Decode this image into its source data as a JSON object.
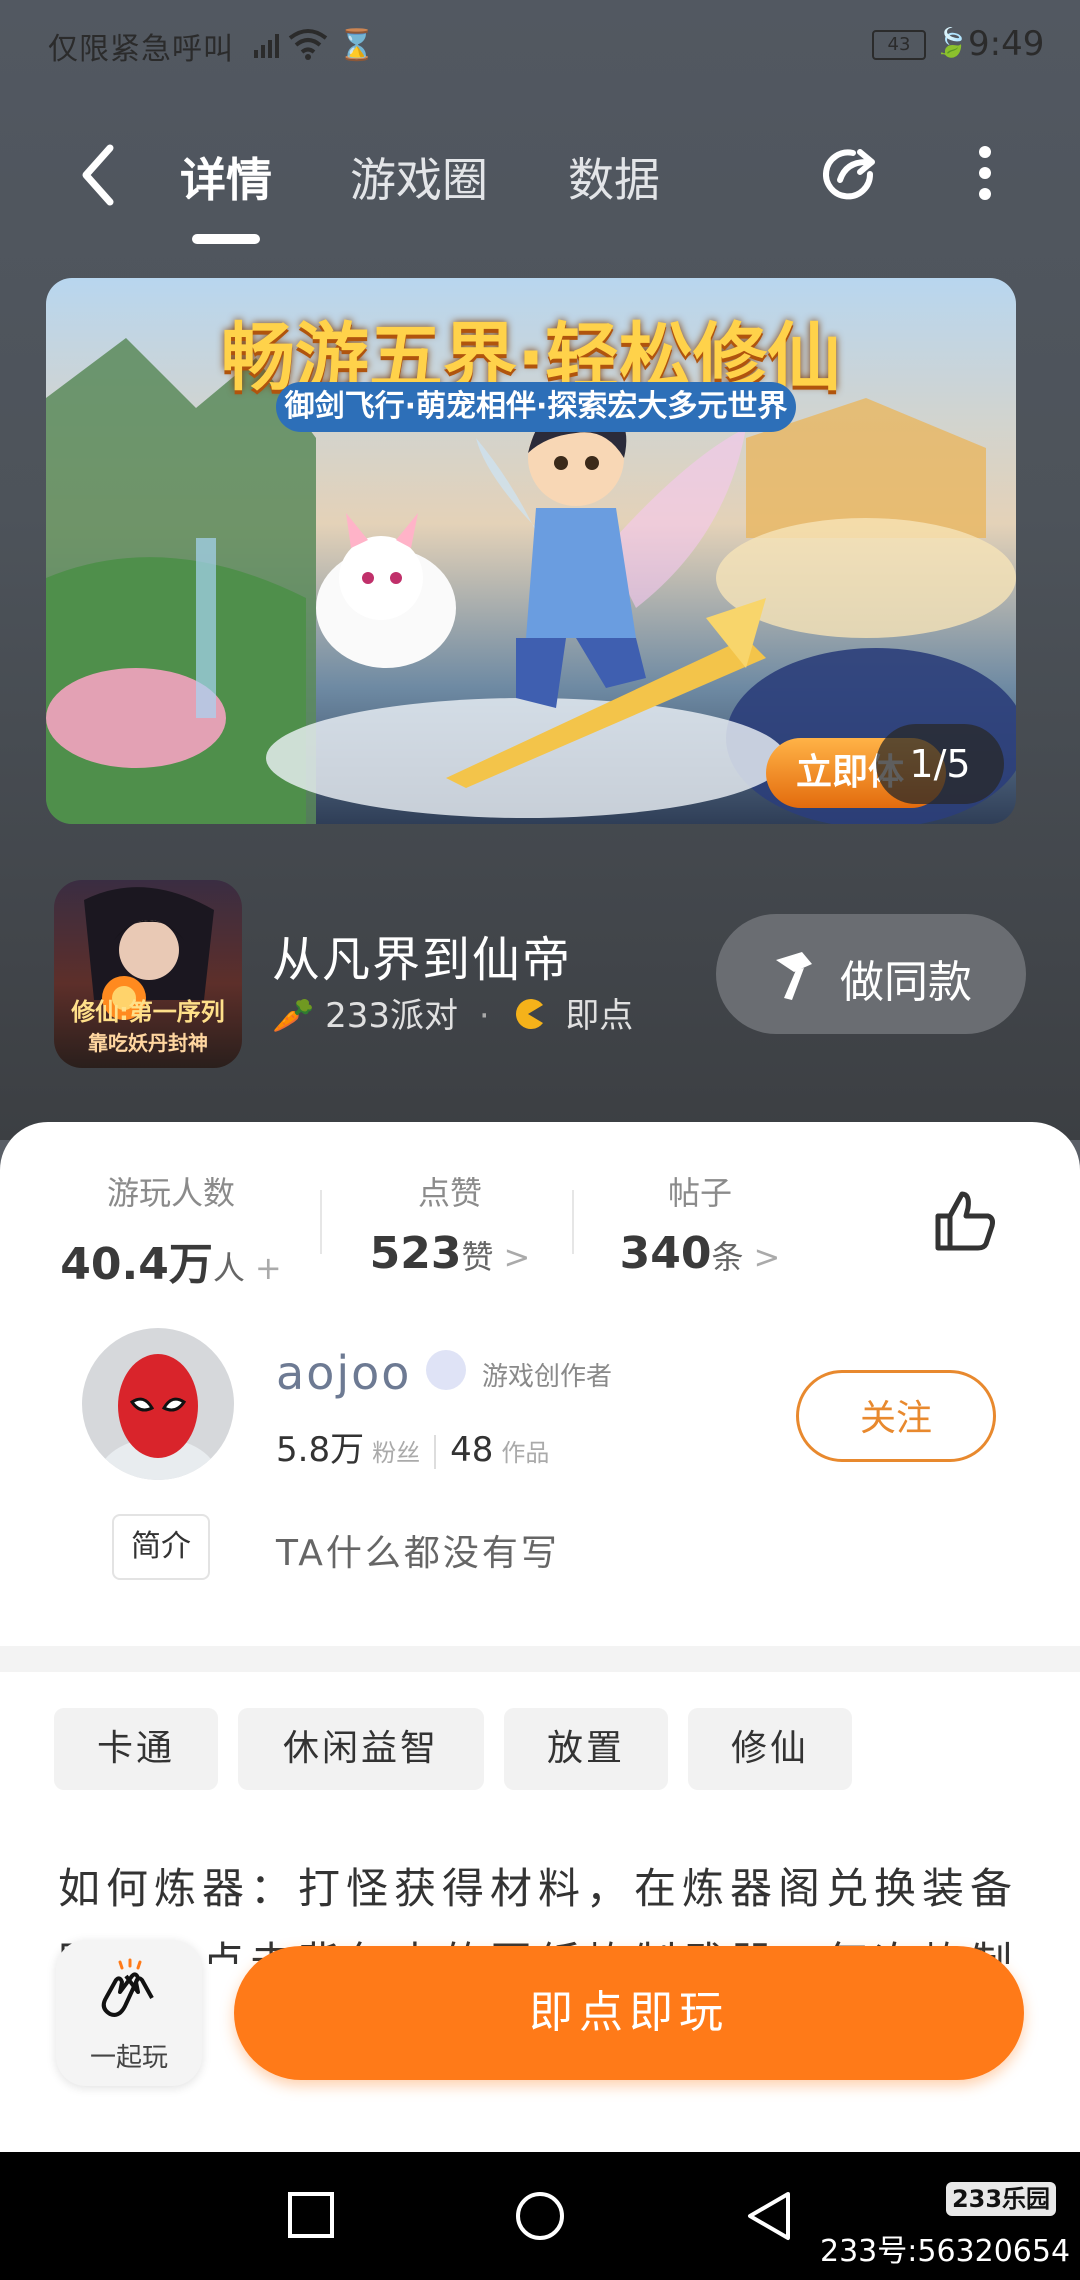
{
  "status_bar": {
    "left_text": "仅限紧急呼叫",
    "battery": "43",
    "time": "9:49"
  },
  "nav": {
    "tabs": [
      {
        "label": "详情"
      },
      {
        "label": "游戏圈"
      },
      {
        "label": "数据"
      }
    ]
  },
  "banner": {
    "title": "畅游五界·轻松修仙",
    "subtitle": "御剑飞行·萌宠相伴·探索宏大多元世界",
    "cta": "立即体",
    "pager": "1/5"
  },
  "game": {
    "icon_caption_line1": "修仙:第一序列",
    "icon_caption_line2": "靠吃妖丹封神",
    "name": "从凡界到仙帝",
    "source": "233派对",
    "type": "即点",
    "make_same_label": "做同款"
  },
  "stats": [
    {
      "label": "游玩人数",
      "value": "40.4万",
      "unit": "人",
      "suffix": "+"
    },
    {
      "label": "点赞",
      "value": "523",
      "unit": "赞",
      "suffix": ">"
    },
    {
      "label": "帖子",
      "value": "340",
      "unit": "条",
      "suffix": ">"
    }
  ],
  "author": {
    "name": "aojoo",
    "role": "游戏创作者",
    "fans_count": "5.8万",
    "fans_label": "粉丝",
    "works_count": "48",
    "works_label": "作品",
    "follow_label": "关注",
    "intro_tag": "简介",
    "intro_text": "TA什么都没有写"
  },
  "tags": [
    "卡通",
    "休闲益智",
    "放置",
    "修仙"
  ],
  "description": "如何炼器：打怪获得材料，在炼器阁兑换装备图纸，点击背包中的图纸炼制武器，每次炼制",
  "bottom": {
    "play_together_label": "一起玩",
    "play_label": "即点即玩"
  },
  "watermark": {
    "badge": "233乐园",
    "id": "233号:56320654"
  },
  "colors": {
    "accent": "#ff7a18",
    "follow": "#e8892e"
  }
}
